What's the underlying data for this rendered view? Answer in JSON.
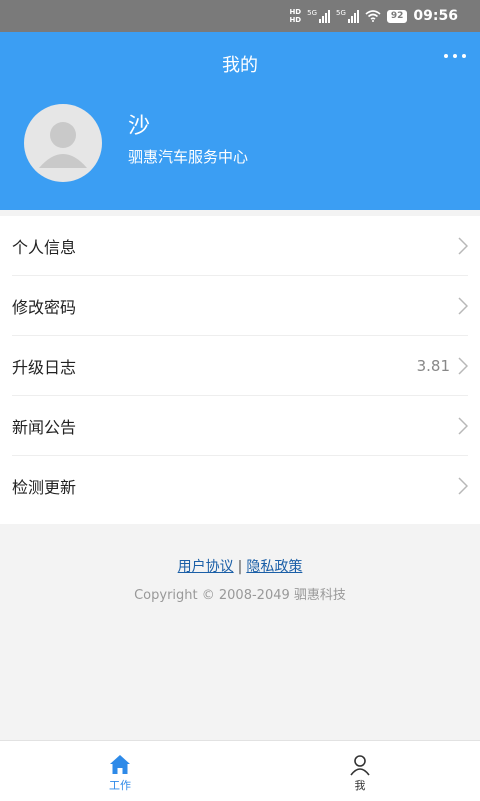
{
  "status_bar": {
    "hd_top": "HD",
    "hd_bottom": "HD",
    "network_1": "5G",
    "network_2": "5G",
    "battery": "92",
    "time": "09:56"
  },
  "header": {
    "title": "我的",
    "more_icon": "more-horizontal-icon",
    "user_name": "沙",
    "organization": "驷惠汽车服务中心"
  },
  "menu": {
    "items": [
      {
        "label": "个人信息",
        "value": ""
      },
      {
        "label": "修改密码",
        "value": ""
      },
      {
        "label": "升级日志",
        "value": "3.81"
      },
      {
        "label": "新闻公告",
        "value": ""
      },
      {
        "label": "检测更新",
        "value": ""
      }
    ]
  },
  "footer": {
    "user_agreement": "用户协议",
    "separator": "|",
    "privacy_policy": "隐私政策",
    "copyright": "Copyright © 2008-2049 驷惠科技"
  },
  "tabbar": {
    "tabs": [
      {
        "label": "工作",
        "icon": "home-icon",
        "active": true
      },
      {
        "label": "我",
        "icon": "person-icon",
        "active": false
      }
    ]
  },
  "colors": {
    "accent": "#3b9ef3",
    "tab_active": "#2e8ae8",
    "link": "#1b5fa7"
  }
}
